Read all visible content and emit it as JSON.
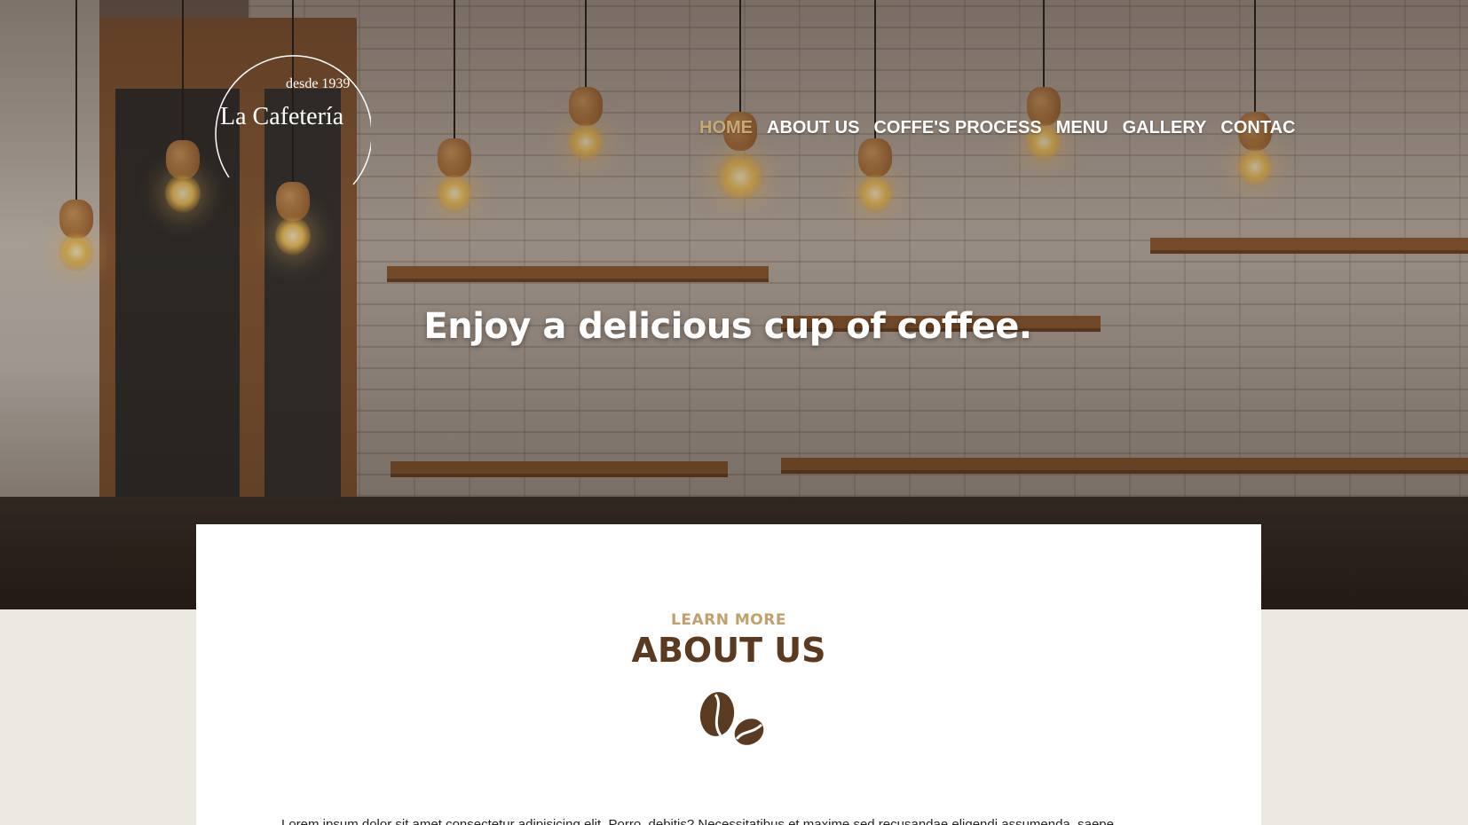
{
  "logo": {
    "since": "desde 1939",
    "name": "La Cafetería"
  },
  "nav": {
    "items": [
      {
        "label": "HOME",
        "active": true
      },
      {
        "label": "ABOUT US",
        "active": false
      },
      {
        "label": "COFFE'S PROCESS",
        "active": false
      },
      {
        "label": "MENU",
        "active": false
      },
      {
        "label": "GALLERY",
        "active": false
      },
      {
        "label": "CONTAC",
        "active": false
      }
    ]
  },
  "hero": {
    "title": "Enjoy a delicious cup of coffee."
  },
  "about": {
    "eyebrow": "LEARN MORE",
    "title": "ABOUT US",
    "icon": "coffee-beans-icon",
    "text": "Lorem ipsum dolor sit amet consectetur adipisicing elit. Porro, debitis? Necessitatibus et maxime sed recusandae eligendi assumenda, saepe"
  },
  "colors": {
    "accent": "#c9a873",
    "brown": "#5b3a22",
    "page_bg": "#ece8e2"
  }
}
